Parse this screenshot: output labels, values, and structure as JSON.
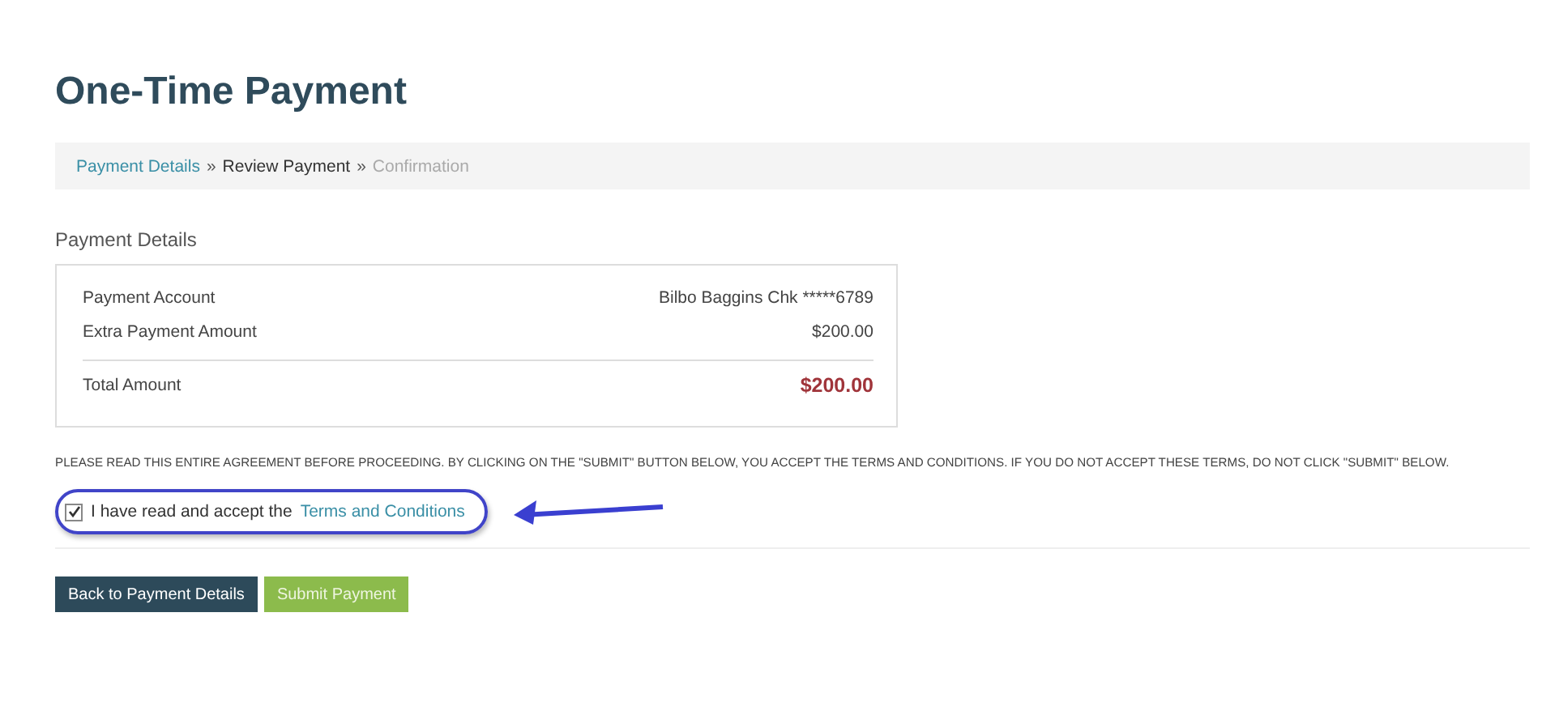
{
  "page_title": "One-Time Payment",
  "breadcrumb": [
    {
      "label": "Payment Details",
      "kind": "link"
    },
    {
      "separator": "»",
      "label": "Review Payment",
      "kind": "current"
    },
    {
      "separator": "»",
      "label": "Confirmation",
      "kind": "upcoming"
    }
  ],
  "section_title": "Payment Details",
  "details": [
    {
      "label": "Payment Account",
      "value": "Bilbo Baggins Chk *****6789",
      "kind": "plain"
    },
    {
      "label": "Extra Payment Amount",
      "value": "$200.00",
      "kind": "plain"
    },
    {
      "label": "Total Amount",
      "value": "$200.00",
      "kind": "total"
    }
  ],
  "agreement": "PLEASE READ THIS ENTIRE AGREEMENT BEFORE PROCEEDING. BY CLICKING ON THE \"SUBMIT\" BUTTON BELOW, YOU ACCEPT THE TERMS AND CONDITIONS. IF YOU DO NOT ACCEPT THESE TERMS, DO NOT CLICK \"SUBMIT\" BELOW.",
  "accept": {
    "checked": true,
    "text": "I have read and accept the",
    "link": "Terms and Conditions"
  },
  "annotation": {
    "circled": true,
    "arrow": true
  },
  "buttons": [
    {
      "label": "Back to Payment Details",
      "kind": "secondary"
    },
    {
      "label": "Submit Payment",
      "kind": "primary"
    }
  ]
}
